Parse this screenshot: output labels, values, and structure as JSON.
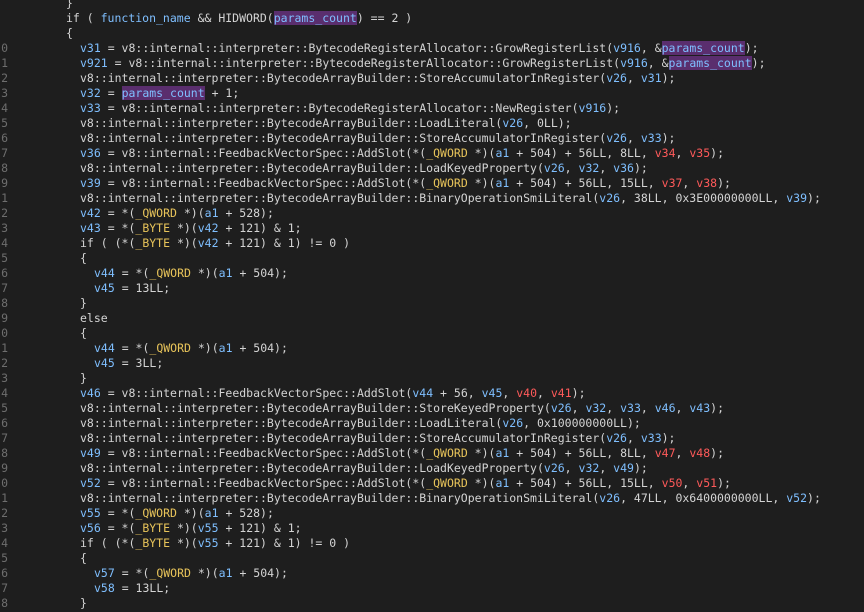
{
  "editor": {
    "background": "#1e1e1e",
    "colors": {
      "text": "#d4d4d4",
      "variable": "#7fbfff",
      "type": "#e8c45a",
      "red_var": "#ff5a5a",
      "highlight_bg": "#5a2e6e"
    },
    "lines": [
      {
        "g": "",
        "i": 66,
        "t": [
          [
            "}",
            "plain"
          ]
        ]
      },
      {
        "g": "",
        "i": 66,
        "t": [
          [
            "if ( ",
            "plain"
          ],
          [
            "function_name",
            "var"
          ],
          [
            " && HIDWORD(",
            "plain"
          ],
          [
            "params_count",
            "hl"
          ],
          [
            ") == 2 )",
            "plain"
          ]
        ]
      },
      {
        "g": "",
        "i": 66,
        "t": [
          [
            "{",
            "plain"
          ]
        ]
      },
      {
        "g": "0",
        "i": 80,
        "t": [
          [
            "v31",
            "var"
          ],
          [
            " = v8::internal::interpreter::BytecodeRegisterAllocator::GrowRegisterList(",
            "plain"
          ],
          [
            "v916",
            "var"
          ],
          [
            ", &",
            "plain"
          ],
          [
            "params_count",
            "hl"
          ],
          [
            ");",
            "plain"
          ]
        ]
      },
      {
        "g": "1",
        "i": 80,
        "t": [
          [
            "v921",
            "var"
          ],
          [
            " = v8::internal::interpreter::BytecodeRegisterAllocator::GrowRegisterList(",
            "plain"
          ],
          [
            "v916",
            "var"
          ],
          [
            ", &",
            "plain"
          ],
          [
            "params_count",
            "hl"
          ],
          [
            ");",
            "plain"
          ]
        ]
      },
      {
        "g": "2",
        "i": 80,
        "t": [
          [
            "v8::internal::interpreter::BytecodeArrayBuilder::StoreAccumulatorInRegister(",
            "plain"
          ],
          [
            "v26",
            "var"
          ],
          [
            ", ",
            "plain"
          ],
          [
            "v31",
            "var"
          ],
          [
            ");",
            "plain"
          ]
        ]
      },
      {
        "g": "3",
        "i": 80,
        "t": [
          [
            "v32",
            "var"
          ],
          [
            " = ",
            "plain"
          ],
          [
            "params_count",
            "hl"
          ],
          [
            " + 1;",
            "plain"
          ]
        ]
      },
      {
        "g": "4",
        "i": 80,
        "t": [
          [
            "v33",
            "var"
          ],
          [
            " = v8::internal::interpreter::BytecodeRegisterAllocator::NewRegister(",
            "plain"
          ],
          [
            "v916",
            "var"
          ],
          [
            ");",
            "plain"
          ]
        ]
      },
      {
        "g": "5",
        "i": 80,
        "t": [
          [
            "v8::internal::interpreter::BytecodeArrayBuilder::LoadLiteral(",
            "plain"
          ],
          [
            "v26",
            "var"
          ],
          [
            ", 0LL);",
            "plain"
          ]
        ]
      },
      {
        "g": "6",
        "i": 80,
        "t": [
          [
            "v8::internal::interpreter::BytecodeArrayBuilder::StoreAccumulatorInRegister(",
            "plain"
          ],
          [
            "v26",
            "var"
          ],
          [
            ", ",
            "plain"
          ],
          [
            "v33",
            "var"
          ],
          [
            ");",
            "plain"
          ]
        ]
      },
      {
        "g": "7",
        "i": 80,
        "t": [
          [
            "v36",
            "var"
          ],
          [
            " = v8::internal::FeedbackVectorSpec::AddSlot(*(",
            "plain"
          ],
          [
            "_QWORD",
            "type"
          ],
          [
            " *)(",
            "plain"
          ],
          [
            "a1",
            "var"
          ],
          [
            " + 504) + 56LL, 8LL, ",
            "plain"
          ],
          [
            "v34",
            "red"
          ],
          [
            ", ",
            "plain"
          ],
          [
            "v35",
            "red"
          ],
          [
            ");",
            "plain"
          ]
        ]
      },
      {
        "g": "8",
        "i": 80,
        "t": [
          [
            "v8::internal::interpreter::BytecodeArrayBuilder::LoadKeyedProperty(",
            "plain"
          ],
          [
            "v26",
            "var"
          ],
          [
            ", ",
            "plain"
          ],
          [
            "v32",
            "var"
          ],
          [
            ", ",
            "plain"
          ],
          [
            "v36",
            "var"
          ],
          [
            ");",
            "plain"
          ]
        ]
      },
      {
        "g": "9",
        "i": 80,
        "t": [
          [
            "v39",
            "var"
          ],
          [
            " = v8::internal::FeedbackVectorSpec::AddSlot(*(",
            "plain"
          ],
          [
            "_QWORD",
            "type"
          ],
          [
            " *)(",
            "plain"
          ],
          [
            "a1",
            "var"
          ],
          [
            " + 504) + 56LL, 15LL, ",
            "plain"
          ],
          [
            "v37",
            "red"
          ],
          [
            ", ",
            "plain"
          ],
          [
            "v38",
            "red"
          ],
          [
            ");",
            "plain"
          ]
        ]
      },
      {
        "g": "1",
        "i": 80,
        "t": [
          [
            "v8::internal::interpreter::BytecodeArrayBuilder::BinaryOperationSmiLiteral(",
            "plain"
          ],
          [
            "v26",
            "var"
          ],
          [
            ", 38LL, 0x3E00000000LL, ",
            "plain"
          ],
          [
            "v39",
            "var"
          ],
          [
            ");",
            "plain"
          ]
        ]
      },
      {
        "g": "2",
        "i": 80,
        "t": [
          [
            "v42",
            "var"
          ],
          [
            " = *(",
            "plain"
          ],
          [
            "_QWORD",
            "type"
          ],
          [
            " *)(",
            "plain"
          ],
          [
            "a1",
            "var"
          ],
          [
            " + 528);",
            "plain"
          ]
        ]
      },
      {
        "g": "3",
        "i": 80,
        "t": [
          [
            "v43",
            "var"
          ],
          [
            " = *(",
            "plain"
          ],
          [
            "_BYTE",
            "type"
          ],
          [
            " *)(",
            "plain"
          ],
          [
            "v42",
            "var"
          ],
          [
            " + 121) & 1;",
            "plain"
          ]
        ]
      },
      {
        "g": "4",
        "i": 80,
        "t": [
          [
            "if ( (*(",
            "plain"
          ],
          [
            "_BYTE",
            "type"
          ],
          [
            " *)(",
            "plain"
          ],
          [
            "v42",
            "var"
          ],
          [
            " + 121) & 1) != 0 )",
            "plain"
          ]
        ]
      },
      {
        "g": "5",
        "i": 80,
        "t": [
          [
            "{",
            "plain"
          ]
        ]
      },
      {
        "g": "6",
        "i": 94,
        "t": [
          [
            "v44",
            "var"
          ],
          [
            " = *(",
            "plain"
          ],
          [
            "_QWORD",
            "type"
          ],
          [
            " *)(",
            "plain"
          ],
          [
            "a1",
            "var"
          ],
          [
            " + 504);",
            "plain"
          ]
        ]
      },
      {
        "g": "7",
        "i": 94,
        "t": [
          [
            "v45",
            "var"
          ],
          [
            " = 13LL;",
            "plain"
          ]
        ]
      },
      {
        "g": "8",
        "i": 80,
        "t": [
          [
            "}",
            "plain"
          ]
        ]
      },
      {
        "g": "9",
        "i": 80,
        "t": [
          [
            "else",
            "plain"
          ]
        ]
      },
      {
        "g": "0",
        "i": 80,
        "t": [
          [
            "{",
            "plain"
          ]
        ]
      },
      {
        "g": "1",
        "i": 94,
        "t": [
          [
            "v44",
            "var"
          ],
          [
            " = *(",
            "plain"
          ],
          [
            "_QWORD",
            "type"
          ],
          [
            " *)(",
            "plain"
          ],
          [
            "a1",
            "var"
          ],
          [
            " + 504);",
            "plain"
          ]
        ]
      },
      {
        "g": "2",
        "i": 94,
        "t": [
          [
            "v45",
            "var"
          ],
          [
            " = 3LL;",
            "plain"
          ]
        ]
      },
      {
        "g": "3",
        "i": 80,
        "t": [
          [
            "}",
            "plain"
          ]
        ]
      },
      {
        "g": "4",
        "i": 80,
        "t": [
          [
            "v46",
            "var"
          ],
          [
            " = v8::internal::FeedbackVectorSpec::AddSlot(",
            "plain"
          ],
          [
            "v44",
            "var"
          ],
          [
            " + 56, ",
            "plain"
          ],
          [
            "v45",
            "var"
          ],
          [
            ", ",
            "plain"
          ],
          [
            "v40",
            "red"
          ],
          [
            ", ",
            "plain"
          ],
          [
            "v41",
            "red"
          ],
          [
            ");",
            "plain"
          ]
        ]
      },
      {
        "g": "5",
        "i": 80,
        "t": [
          [
            "v8::internal::interpreter::BytecodeArrayBuilder::StoreKeyedProperty(",
            "plain"
          ],
          [
            "v26",
            "var"
          ],
          [
            ", ",
            "plain"
          ],
          [
            "v32",
            "var"
          ],
          [
            ", ",
            "plain"
          ],
          [
            "v33",
            "var"
          ],
          [
            ", ",
            "plain"
          ],
          [
            "v46",
            "var"
          ],
          [
            ", ",
            "plain"
          ],
          [
            "v43",
            "var"
          ],
          [
            ");",
            "plain"
          ]
        ]
      },
      {
        "g": "6",
        "i": 80,
        "t": [
          [
            "v8::internal::interpreter::BytecodeArrayBuilder::LoadLiteral(",
            "plain"
          ],
          [
            "v26",
            "var"
          ],
          [
            ", 0x100000000LL);",
            "plain"
          ]
        ]
      },
      {
        "g": "7",
        "i": 80,
        "t": [
          [
            "v8::internal::interpreter::BytecodeArrayBuilder::StoreAccumulatorInRegister(",
            "plain"
          ],
          [
            "v26",
            "var"
          ],
          [
            ", ",
            "plain"
          ],
          [
            "v33",
            "var"
          ],
          [
            ");",
            "plain"
          ]
        ]
      },
      {
        "g": "8",
        "i": 80,
        "t": [
          [
            "v49",
            "var"
          ],
          [
            " = v8::internal::FeedbackVectorSpec::AddSlot(*(",
            "plain"
          ],
          [
            "_QWORD",
            "type"
          ],
          [
            " *)(",
            "plain"
          ],
          [
            "a1",
            "var"
          ],
          [
            " + 504) + 56LL, 8LL, ",
            "plain"
          ],
          [
            "v47",
            "red"
          ],
          [
            ", ",
            "plain"
          ],
          [
            "v48",
            "red"
          ],
          [
            ");",
            "plain"
          ]
        ]
      },
      {
        "g": "9",
        "i": 80,
        "t": [
          [
            "v8::internal::interpreter::BytecodeArrayBuilder::LoadKeyedProperty(",
            "plain"
          ],
          [
            "v26",
            "var"
          ],
          [
            ", ",
            "plain"
          ],
          [
            "v32",
            "var"
          ],
          [
            ", ",
            "plain"
          ],
          [
            "v49",
            "var"
          ],
          [
            ");",
            "plain"
          ]
        ]
      },
      {
        "g": "0",
        "i": 80,
        "t": [
          [
            "v52",
            "var"
          ],
          [
            " = v8::internal::FeedbackVectorSpec::AddSlot(*(",
            "plain"
          ],
          [
            "_QWORD",
            "type"
          ],
          [
            " *)(",
            "plain"
          ],
          [
            "a1",
            "var"
          ],
          [
            " + 504) + 56LL, 15LL, ",
            "plain"
          ],
          [
            "v50",
            "red"
          ],
          [
            ", ",
            "plain"
          ],
          [
            "v51",
            "red"
          ],
          [
            ");",
            "plain"
          ]
        ]
      },
      {
        "g": "1",
        "i": 80,
        "t": [
          [
            "v8::internal::interpreter::BytecodeArrayBuilder::BinaryOperationSmiLiteral(",
            "plain"
          ],
          [
            "v26",
            "var"
          ],
          [
            ", 47LL, 0x6400000000LL, ",
            "plain"
          ],
          [
            "v52",
            "var"
          ],
          [
            ");",
            "plain"
          ]
        ]
      },
      {
        "g": "2",
        "i": 80,
        "t": [
          [
            "v55",
            "var"
          ],
          [
            " = *(",
            "plain"
          ],
          [
            "_QWORD",
            "type"
          ],
          [
            " *)(",
            "plain"
          ],
          [
            "a1",
            "var"
          ],
          [
            " + 528);",
            "plain"
          ]
        ]
      },
      {
        "g": "3",
        "i": 80,
        "t": [
          [
            "v56",
            "var"
          ],
          [
            " = *(",
            "plain"
          ],
          [
            "_BYTE",
            "type"
          ],
          [
            " *)(",
            "plain"
          ],
          [
            "v55",
            "var"
          ],
          [
            " + 121) & 1;",
            "plain"
          ]
        ]
      },
      {
        "g": "4",
        "i": 80,
        "t": [
          [
            "if ( (*(",
            "plain"
          ],
          [
            "_BYTE",
            "type"
          ],
          [
            " *)(",
            "plain"
          ],
          [
            "v55",
            "var"
          ],
          [
            " + 121) & 1) != 0 )",
            "plain"
          ]
        ]
      },
      {
        "g": "5",
        "i": 80,
        "t": [
          [
            "{",
            "plain"
          ]
        ]
      },
      {
        "g": "6",
        "i": 94,
        "t": [
          [
            "v57",
            "var"
          ],
          [
            " = *(",
            "plain"
          ],
          [
            "_QWORD",
            "type"
          ],
          [
            " *)(",
            "plain"
          ],
          [
            "a1",
            "var"
          ],
          [
            " + 504);",
            "plain"
          ]
        ]
      },
      {
        "g": "7",
        "i": 94,
        "t": [
          [
            "v58",
            "var"
          ],
          [
            " = 13LL;",
            "plain"
          ]
        ]
      },
      {
        "g": "8",
        "i": 80,
        "t": [
          [
            "}",
            "plain"
          ]
        ]
      },
      {
        "g": "",
        "i": 80,
        "t": [
          [
            "}",
            "plain"
          ]
        ]
      }
    ]
  }
}
